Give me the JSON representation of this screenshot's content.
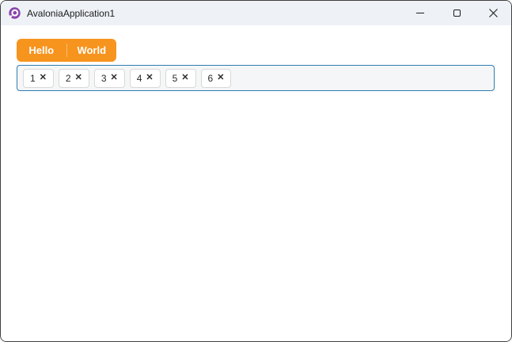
{
  "window": {
    "title": "AvaloniaApplication1",
    "app_icon": "avalonia-logo",
    "controls": [
      {
        "name": "minimize",
        "icon": "minimize-icon"
      },
      {
        "name": "maximize",
        "icon": "maximize-icon"
      },
      {
        "name": "close",
        "icon": "close-icon"
      }
    ]
  },
  "toolbar": {
    "buttons": [
      {
        "label": "Hello"
      },
      {
        "label": "World"
      }
    ]
  },
  "chip_input": {
    "chips": [
      {
        "label": "1"
      },
      {
        "label": "2"
      },
      {
        "label": "3"
      },
      {
        "label": "4"
      },
      {
        "label": "5"
      },
      {
        "label": "6"
      }
    ],
    "remove_glyph": "✕"
  },
  "colors": {
    "accent_orange": "#F7941E",
    "focus_border_blue": "#2E7CAF",
    "titlebar_bg": "#EEF2F7",
    "logo_purple": "#8B44AC",
    "chip_bg": "#FFFFFF",
    "chip_border": "#D8D8D8",
    "chip_strip_bg": "#F5F6F7",
    "window_border": "#3F3F3F",
    "text_dark": "#1B1B1B"
  }
}
